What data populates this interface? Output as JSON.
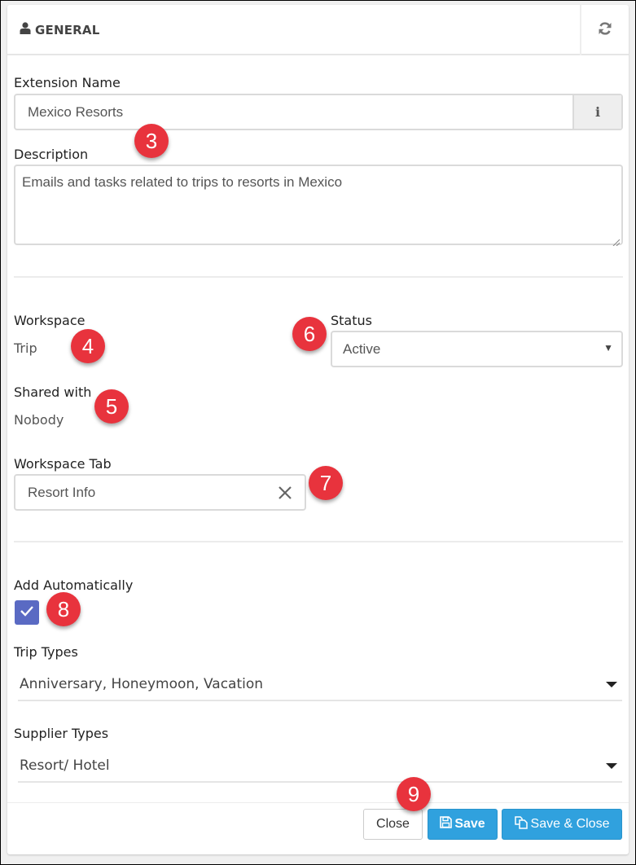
{
  "panel": {
    "title": "GENERAL",
    "icon": "user-icon",
    "refresh_icon": "refresh-icon"
  },
  "form": {
    "extension_name": {
      "label": "Extension Name",
      "value": "Mexico Resorts",
      "addon_icon": "info-icon",
      "addon_glyph": "i"
    },
    "description": {
      "label": "Description",
      "value": "Emails and tasks related to trips to resorts in Mexico"
    },
    "workspace": {
      "label": "Workspace",
      "value": "Trip"
    },
    "status": {
      "label": "Status",
      "selected": "Active"
    },
    "shared_with": {
      "label": "Shared with",
      "value": "Nobody"
    },
    "workspace_tab": {
      "label": "Workspace Tab",
      "value": "Resort Info",
      "clear_icon": "close-icon"
    },
    "add_automatically": {
      "label": "Add Automatically",
      "checked": true
    },
    "trip_types": {
      "label": "Trip Types",
      "value": "Anniversary, Honeymoon, Vacation"
    },
    "supplier_types": {
      "label": "Supplier Types",
      "value": "Resort/ Hotel"
    }
  },
  "footer": {
    "close_label": "Close",
    "save_label": "Save",
    "save_close_label": "Save & Close"
  },
  "annotations": [
    "3",
    "4",
    "5",
    "6",
    "7",
    "8",
    "9"
  ],
  "colors": {
    "primary_button": "#30a1de",
    "checkbox": "#5a6ac3",
    "badge": "#e8333d"
  }
}
